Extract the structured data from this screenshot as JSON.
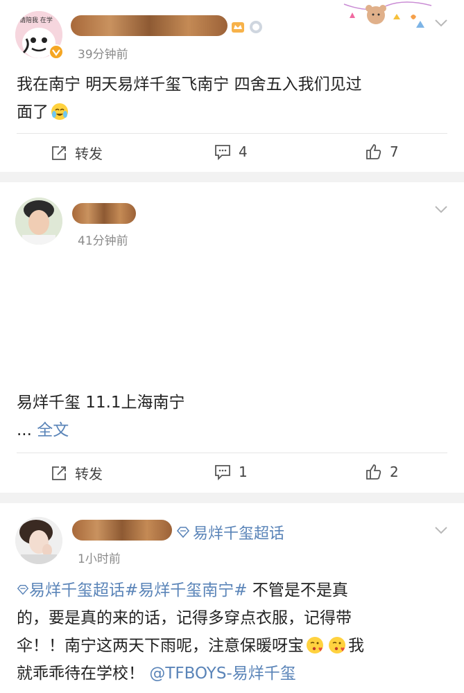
{
  "posts": [
    {
      "time": "39分钟前",
      "text_line1": "我在南宁  明天易烊千玺飞南宁  四舍五入我们见过",
      "text_line2": "面了",
      "actions": {
        "repost": "转发",
        "comments": "4",
        "likes": "7"
      }
    },
    {
      "time": "41分钟前",
      "text_line1": "易烊千玺 11.1上海南宁",
      "ellipsis": "...",
      "full_text_link": "全文",
      "actions": {
        "repost": "转发",
        "comments": "1",
        "likes": "2"
      }
    },
    {
      "time": "1小时前",
      "topic_tag": "易烊千玺超话",
      "text_seg1": "易烊千玺超话#易烊千玺南宁#",
      "text_seg2": " 不管是不是真",
      "text_line2": "的，要是真的来的话，记得多穿点衣服，记得带",
      "text_line3": "伞！！南宁这两天下雨呢，注意保暖呀宝",
      "text_line3_after": "我",
      "text_line4": "就乖乖待在学校！",
      "mention": "@TFBOYS-易烊千玺"
    }
  ],
  "avatar1_text": "请陪我 在学",
  "colors": {
    "link": "#5a84b8",
    "verified": "#f5a623",
    "divider": "#e6e6e6"
  },
  "icons": [
    "repost-icon",
    "comment-icon",
    "like-icon",
    "chevron-down-icon",
    "verified-badge-icon",
    "super-topic-icon",
    "crying-laugh-emoji-icon",
    "kiss-emoji-icon"
  ]
}
